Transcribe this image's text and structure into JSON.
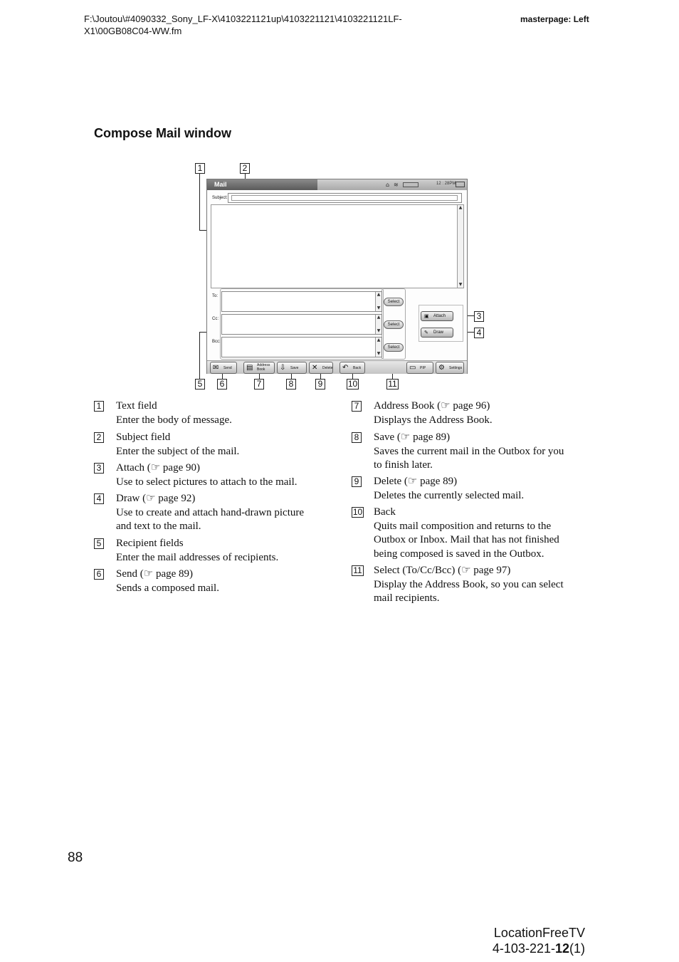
{
  "header": {
    "path_line1": "F:\\Joutou\\#4090332_Sony_LF-X\\4103221121up\\4103221121\\4103221121LF-",
    "path_line2": "X1\\00GB08C04-WW.fm",
    "masterpage": "masterpage: Left"
  },
  "section_title": "Compose Mail window",
  "screen": {
    "window_title": "Mail",
    "clock": "12 : 28PM",
    "subject_label": "Subject:",
    "recipients": [
      {
        "label": "To:",
        "select": "Select"
      },
      {
        "label": "Cc:",
        "select": "Select"
      },
      {
        "label": "Bcc:",
        "select": "Select"
      }
    ],
    "side_buttons": [
      {
        "label": "Attach",
        "icon": "image-icon"
      },
      {
        "label": "Draw",
        "icon": "pen-icon"
      }
    ],
    "toolbar": [
      {
        "label": "Send",
        "icon": "send-icon"
      },
      {
        "label": "Address Book",
        "icon": "address-book-icon"
      },
      {
        "label": "Save",
        "icon": "save-icon"
      },
      {
        "label": "Delete",
        "icon": "delete-icon"
      },
      {
        "label": "Back",
        "icon": "back-icon"
      },
      {
        "label": "PIP",
        "icon": "pip-icon"
      },
      {
        "label": "Settings",
        "icon": "settings-icon"
      }
    ]
  },
  "callouts": {
    "c1": "1",
    "c2": "2",
    "c3": "3",
    "c4": "4",
    "c5": "5",
    "c6": "6",
    "c7": "7",
    "c8": "8",
    "c9": "9",
    "c10": "10",
    "c11": "11"
  },
  "descriptions_left": [
    {
      "num": "1",
      "title": "Text field",
      "lines": [
        "Enter the body of message."
      ]
    },
    {
      "num": "2",
      "title": "Subject field",
      "lines": [
        "Enter the subject of the mail."
      ]
    },
    {
      "num": "3",
      "title": "Attach (☞ page 90)",
      "lines": [
        "Use to select pictures to attach to the mail."
      ]
    },
    {
      "num": "4",
      "title": "Draw (☞ page 92)",
      "lines": [
        "Use to create and attach hand-drawn picture",
        "and text to the mail."
      ]
    },
    {
      "num": "5",
      "title": "Recipient fields",
      "lines": [
        "Enter the mail addresses of recipients."
      ]
    },
    {
      "num": "6",
      "title": "Send (☞ page 89)",
      "lines": [
        "Sends a composed mail."
      ]
    }
  ],
  "descriptions_right": [
    {
      "num": "7",
      "title": "Address Book (☞ page 96)",
      "lines": [
        "Displays the Address Book."
      ]
    },
    {
      "num": "8",
      "title": "Save (☞ page 89)",
      "lines": [
        "Saves the current mail in the Outbox for you",
        "to finish later."
      ]
    },
    {
      "num": "9",
      "title": "Delete (☞ page 89)",
      "lines": [
        "Deletes the currently selected mail."
      ]
    },
    {
      "num": "10",
      "title": "Back",
      "lines": [
        "Quits mail composition and returns to the",
        "Outbox or Inbox. Mail that has not finished",
        "being composed is saved in the Outbox."
      ]
    },
    {
      "num": "11",
      "title": "Select (To/Cc/Bcc) (☞ page 97)",
      "lines": [
        "Display the Address Book, so you can select",
        "mail recipients."
      ]
    }
  ],
  "page_number": "88",
  "footer": {
    "product": "LocationFreeTV",
    "code_prefix": "4-103-221-",
    "code_bold": "12",
    "code_suffix": "(1)"
  }
}
